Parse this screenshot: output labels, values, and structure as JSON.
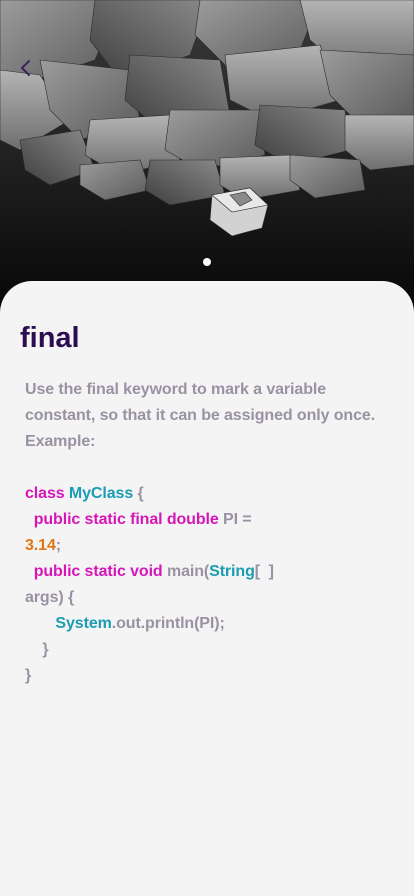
{
  "header": {
    "back_icon": "chevron-left-icon",
    "accent_color": "#2b0d50",
    "carousel": {
      "page_count": 1,
      "active_index": 0
    }
  },
  "lesson": {
    "title": "final",
    "description_lines": [
      "Use the final keyword to mark a variable",
      "constant, so that it can be assigned only once.",
      "Example:"
    ],
    "code": {
      "l1": {
        "kw": "class",
        "type": "MyClass",
        "rest": " {"
      },
      "l2": {
        "indent": "  ",
        "kw": "public static final double",
        "rest": " PI ="
      },
      "l3": {
        "num": "3.14",
        "rest": ";"
      },
      "l4": {
        "indent": "  ",
        "kw": "public static void",
        "mid": " main(",
        "type": "String",
        "rest": "[  ]"
      },
      "l5": {
        "text": "args) {"
      },
      "l6": {
        "indent": "       ",
        "type": "System",
        "rest": ".out.println(PI);"
      },
      "l7": {
        "text": "    }"
      },
      "l8": {
        "text": "}"
      }
    },
    "colors": {
      "keyword": "#d516b9",
      "type": "#1b9cb3",
      "number": "#e07613",
      "text": "#9a92a3"
    }
  }
}
